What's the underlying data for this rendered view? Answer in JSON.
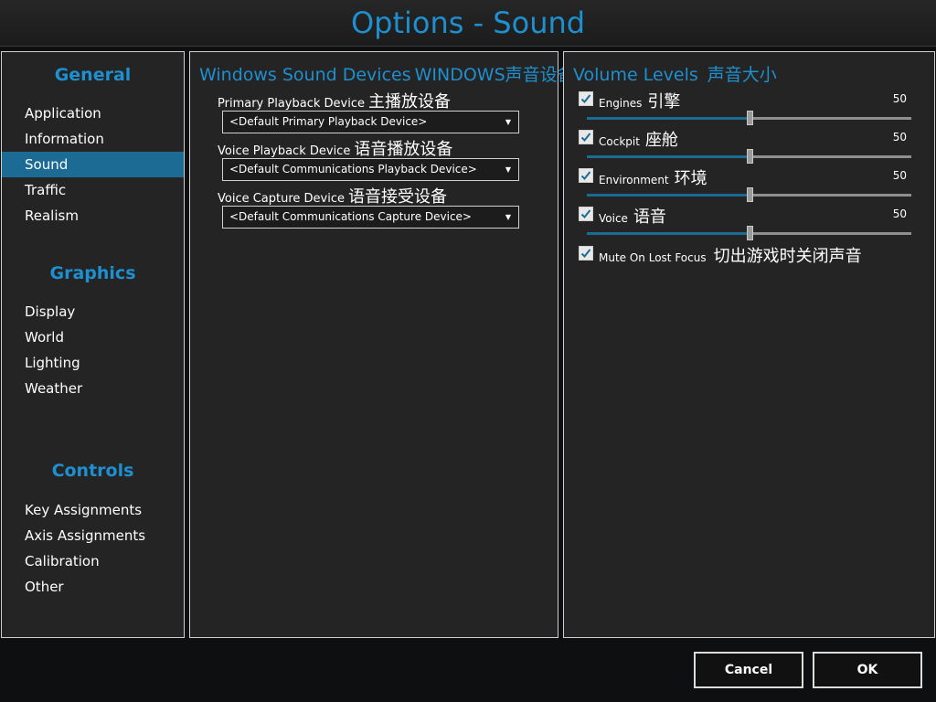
{
  "window": {
    "title": "Options - Sound"
  },
  "nav": {
    "sections": [
      {
        "heading": "General",
        "items": [
          "Application",
          "Information",
          "Sound",
          "Traffic",
          "Realism"
        ]
      },
      {
        "heading": "Graphics",
        "items": [
          "Display",
          "World",
          "Lighting",
          "Weather"
        ]
      },
      {
        "heading": "Controls",
        "items": [
          "Key Assignments",
          "Axis Assignments",
          "Calibration",
          "Other"
        ]
      }
    ],
    "active_item": "Sound"
  },
  "devices": {
    "title": "Windows Sound Devices",
    "title_cn": "WINDOWS声音设备",
    "fields": [
      {
        "label": "Primary Playback Device",
        "label_cn": "主播放设备",
        "value": "<Default Primary Playback Device>"
      },
      {
        "label": "Voice Playback Device",
        "label_cn": "语音播放设备",
        "value": "<Default Communications Playback Device>"
      },
      {
        "label": "Voice Capture Device",
        "label_cn": "语音接受设备",
        "value": "<Default Communications Capture Device>"
      }
    ]
  },
  "volume": {
    "title": "Volume Levels",
    "title_cn": "声音大小",
    "sliders": [
      {
        "label": "Engines",
        "label_cn": "引擎",
        "checked": true,
        "value": "50",
        "level": 0.5
      },
      {
        "label": "Cockpit",
        "label_cn": "座舱",
        "checked": true,
        "value": "50",
        "level": 0.5
      },
      {
        "label": "Environment",
        "label_cn": "环境",
        "checked": true,
        "value": "50",
        "level": 0.5
      },
      {
        "label": "Voice",
        "label_cn": "语音",
        "checked": true,
        "value": "50",
        "level": 0.5
      }
    ],
    "mute": {
      "label": "Mute On Lost Focus",
      "label_cn": "切出游戏时关闭声音",
      "checked": true
    }
  },
  "buttons": {
    "cancel": "Cancel",
    "ok": "OK"
  },
  "icons": {
    "checkbox_check": "check-icon",
    "dropdown_arrow": "triangle-down-icon"
  },
  "colors": {
    "accent": "#1e8fcf",
    "selection": "#1b6b95"
  }
}
